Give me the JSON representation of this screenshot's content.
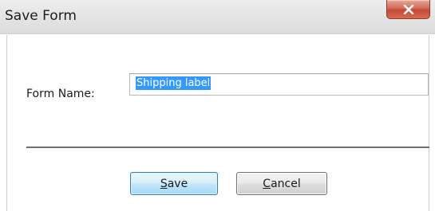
{
  "window": {
    "title": "Save Form"
  },
  "form": {
    "name_label": "Form Name:",
    "name_value": "Shipping label"
  },
  "buttons": {
    "save_mnemonic": "S",
    "save_rest": "ave",
    "cancel_mnemonic": "C",
    "cancel_rest": "ancel"
  },
  "icons": {
    "close": "close-icon"
  },
  "colors": {
    "selection": "#3399ff",
    "close_button": "#c9503b",
    "default_button_border": "#3c7fb1"
  }
}
